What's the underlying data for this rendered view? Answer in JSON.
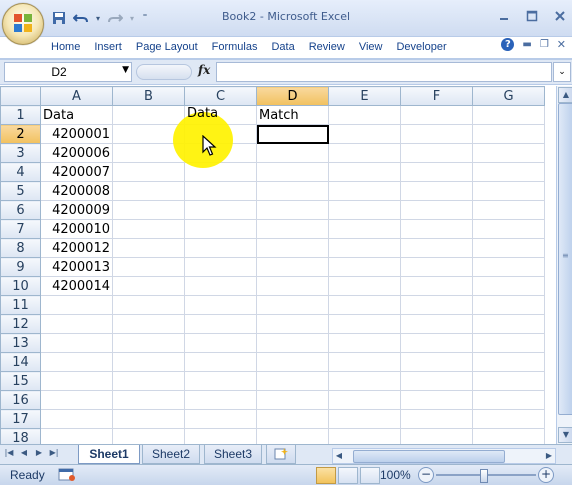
{
  "window": {
    "title": "Book2 - Microsoft Excel"
  },
  "quick_access": {
    "icons": [
      "save-icon",
      "undo-icon",
      "redo-icon",
      "customize-icon"
    ]
  },
  "ribbon": {
    "tabs": [
      "Home",
      "Insert",
      "Page Layout",
      "Formulas",
      "Data",
      "Review",
      "View",
      "Developer"
    ]
  },
  "formula_bar": {
    "name_box": "D2",
    "fx": "fx",
    "formula": ""
  },
  "sheet": {
    "columns": [
      "A",
      "B",
      "C",
      "D",
      "E",
      "F",
      "G"
    ],
    "rows": [
      {
        "num": "1",
        "A": "Data",
        "B": "",
        "C": "Data",
        "D": "Match"
      },
      {
        "num": "2",
        "A": "4200001",
        "B": "",
        "C": "",
        "D": ""
      },
      {
        "num": "3",
        "A": "4200006",
        "B": "",
        "C": "",
        "D": ""
      },
      {
        "num": "4",
        "A": "4200007",
        "B": "",
        "C": "",
        "D": ""
      },
      {
        "num": "5",
        "A": "4200008",
        "B": "",
        "C": "",
        "D": ""
      },
      {
        "num": "6",
        "A": "4200009",
        "B": "",
        "C": "",
        "D": ""
      },
      {
        "num": "7",
        "A": "4200010",
        "B": "",
        "C": "",
        "D": ""
      },
      {
        "num": "8",
        "A": "4200012",
        "B": "",
        "C": "",
        "D": ""
      },
      {
        "num": "9",
        "A": "4200013",
        "B": "",
        "C": "",
        "D": ""
      },
      {
        "num": "10",
        "A": "4200014",
        "B": "",
        "C": "",
        "D": ""
      },
      {
        "num": "11",
        "A": "",
        "B": "",
        "C": "",
        "D": ""
      },
      {
        "num": "12",
        "A": "",
        "B": "",
        "C": "",
        "D": ""
      },
      {
        "num": "13",
        "A": "",
        "B": "",
        "C": "",
        "D": ""
      },
      {
        "num": "14",
        "A": "",
        "B": "",
        "C": "",
        "D": ""
      },
      {
        "num": "15",
        "A": "",
        "B": "",
        "C": "",
        "D": ""
      },
      {
        "num": "16",
        "A": "",
        "B": "",
        "C": "",
        "D": ""
      },
      {
        "num": "17",
        "A": "",
        "B": "",
        "C": "",
        "D": ""
      },
      {
        "num": "18",
        "A": "",
        "B": "",
        "C": "",
        "D": ""
      }
    ]
  },
  "sheet_tabs": {
    "tabs": [
      "Sheet1",
      "Sheet2",
      "Sheet3"
    ],
    "active": "Sheet1"
  },
  "status": {
    "text": "Ready",
    "zoom": "100%",
    "zoom_minus": "−",
    "zoom_plus": "+"
  },
  "colors": {
    "ribbon_bg": "#dfe8f5",
    "header_text": "#15428b",
    "selected_header": "#f1c15f",
    "cursor_highlight": "#fff200"
  }
}
